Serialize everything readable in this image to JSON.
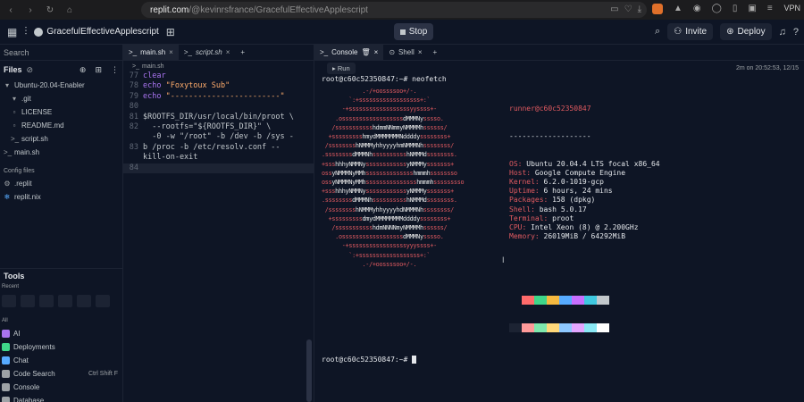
{
  "browser": {
    "url_host": "replit.com",
    "url_path": "/@kevinrsfrance/GracefulEffectiveApplescript",
    "vpn": "VPN"
  },
  "header": {
    "repl_name": "GracefulEffectiveApplescript",
    "stop_label": "Stop",
    "invite_label": "Invite",
    "deploy_label": "Deploy"
  },
  "sidebar": {
    "search": "Search",
    "files_title": "Files",
    "tree": [
      {
        "name": "Ubuntu-20.04-Enabler",
        "icon": "folder-icon",
        "indent": 0
      },
      {
        "name": ".git",
        "icon": "folder-icon",
        "indent": 1
      },
      {
        "name": "LICENSE",
        "icon": "file-icon",
        "indent": 1
      },
      {
        "name": "README.md",
        "icon": "file-icon",
        "indent": 1
      },
      {
        "name": "script.sh",
        "icon": "shell-icon",
        "indent": 1
      },
      {
        "name": "main.sh",
        "icon": "shell-icon",
        "indent": 0
      }
    ],
    "config_title": "Config files",
    "config_files": [
      {
        "name": ".replit",
        "icon": "gear-icon"
      },
      {
        "name": "replit.nix",
        "icon": "nix-icon"
      }
    ],
    "tools_title": "Tools",
    "recent_label": "Recent",
    "all_label": "All",
    "tools": [
      {
        "name": "AI",
        "color": "#a974f0",
        "shortcut": ""
      },
      {
        "name": "Deployments",
        "color": "#3fd68a",
        "shortcut": ""
      },
      {
        "name": "Chat",
        "color": "#57abff",
        "shortcut": ""
      },
      {
        "name": "Code Search",
        "color": "#9da2a6",
        "shortcut": "Ctrl Shift F"
      },
      {
        "name": "Console",
        "color": "#9da2a6",
        "shortcut": ""
      },
      {
        "name": "Database",
        "color": "#9da2a6",
        "shortcut": ""
      }
    ]
  },
  "editor": {
    "tabs": [
      {
        "label": "main.sh",
        "active": true
      },
      {
        "label": "script.sh",
        "active": false
      }
    ],
    "filename": "main.sh",
    "lines": [
      {
        "n": "77",
        "parts": [
          {
            "t": "clear",
            "c": "kw"
          }
        ]
      },
      {
        "n": "78",
        "parts": [
          {
            "t": "echo ",
            "c": "kw"
          },
          {
            "t": "\"Foxytoux Sub\"",
            "c": "str"
          }
        ]
      },
      {
        "n": "79",
        "parts": [
          {
            "t": "echo ",
            "c": "kw"
          },
          {
            "t": "\"------------------------\"",
            "c": "str"
          }
        ]
      },
      {
        "n": "80",
        "parts": []
      },
      {
        "n": "81",
        "parts": [
          {
            "t": "$ROOTFS_DIR/usr/local/bin/proot \\",
            "c": "plain"
          }
        ]
      },
      {
        "n": "82",
        "parts": [
          {
            "t": "  --rootfs=\"${ROOTFS_DIR}\" \\",
            "c": "plain"
          }
        ]
      },
      {
        "n": "",
        "parts": [
          {
            "t": "  -0 -w \"/root\" -b /dev -b /sys -",
            "c": "plain"
          }
        ]
      },
      {
        "n": "83",
        "parts": [
          {
            "t": "b /proc -b /etc/resolv.conf --",
            "c": "plain"
          }
        ]
      },
      {
        "n": "",
        "parts": [
          {
            "t": "kill-on-exit",
            "c": "plain"
          }
        ]
      },
      {
        "n": "84",
        "parts": [],
        "active": true
      }
    ]
  },
  "console": {
    "tabs": [
      {
        "label": "Console",
        "active": true
      },
      {
        "label": "Shell",
        "active": false
      }
    ],
    "run_label": "Run",
    "timestamp": "2m on 20:52:53, 12/15",
    "prompt1": "root@c60c52350847:~# neofetch",
    "user_host": "runner@c60c52350847",
    "separator": "-------------------",
    "info": [
      {
        "k": "OS",
        "v": "Ubuntu 20.04.4 LTS focal x86_64"
      },
      {
        "k": "Host",
        "v": "Google Compute Engine"
      },
      {
        "k": "Kernel",
        "v": "6.2.0-1019-gcp"
      },
      {
        "k": "Uptime",
        "v": "6 hours, 24 mins"
      },
      {
        "k": "Packages",
        "v": "158 (dpkg)"
      },
      {
        "k": "Shell",
        "v": "bash 5.0.17"
      },
      {
        "k": "Terminal",
        "v": "proot"
      },
      {
        "k": "CPU",
        "v": "Intel Xeon (8) @ 2.200GHz"
      },
      {
        "k": "Memory",
        "v": "26019MiB / 64292MiB"
      }
    ],
    "palette": [
      "#0e1525",
      "#ff6b6b",
      "#3fd68a",
      "#f5b940",
      "#57abff",
      "#c86fff",
      "#3fc8e0",
      "#c2c8cc",
      "#1c2333",
      "#ff9a9a",
      "#7ee8ad",
      "#ffd87a",
      "#8ec8ff",
      "#e3a6ff",
      "#8ae8f5",
      "#ffffff"
    ],
    "prompt2": "root@c60c52350847:~# "
  }
}
